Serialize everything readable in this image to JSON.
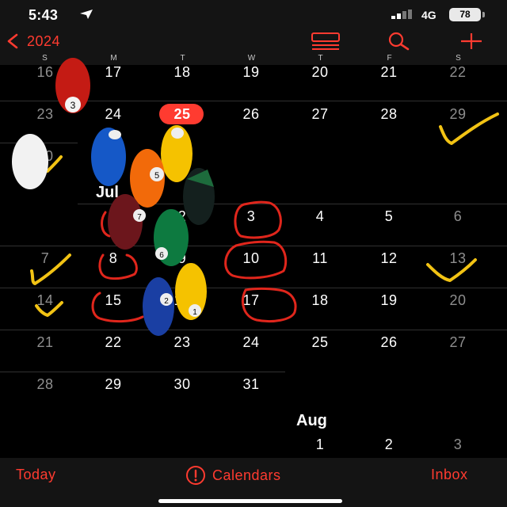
{
  "status_bar": {
    "time": "5:43",
    "network": "4G",
    "battery": "78"
  },
  "nav": {
    "back_label": "2024",
    "weekdays": [
      "S",
      "M",
      "T",
      "W",
      "T",
      "F",
      "S"
    ]
  },
  "calendar": {
    "june_week4": [
      "16",
      "17",
      "18",
      "19",
      "20",
      "21",
      "22"
    ],
    "june_week5": [
      "23",
      "24",
      "25",
      "26",
      "27",
      "28",
      "29"
    ],
    "june_last": "30",
    "july_label": "Jul",
    "july_week1": [
      "1",
      "2",
      "3",
      "4",
      "5",
      "6"
    ],
    "july_week2": [
      "7",
      "8",
      "9",
      "10",
      "11",
      "12",
      "13"
    ],
    "july_week3": [
      "14",
      "15",
      "16",
      "17",
      "18",
      "19",
      "20"
    ],
    "july_week4": [
      "21",
      "22",
      "23",
      "24",
      "25",
      "26",
      "27"
    ],
    "july_week5": [
      "28",
      "29",
      "30",
      "31"
    ],
    "aug_label": "Aug",
    "aug_week1": [
      "1",
      "2",
      "3"
    ],
    "today": "25"
  },
  "tab_bar": {
    "today": "Today",
    "calendars": "Calendars",
    "inbox": "Inbox"
  },
  "overlay_stickers": {
    "pool_balls": [
      {
        "number": "3"
      },
      {
        "number": ""
      },
      {
        "number": ""
      },
      {
        "number": ""
      },
      {
        "number": "5"
      },
      {
        "number": ""
      },
      {
        "number": "7"
      },
      {
        "number": "6"
      },
      {
        "number": "2"
      },
      {
        "number": "1"
      }
    ]
  },
  "colors": {
    "accent": "#ff3b30",
    "background": "#000000",
    "bar": "#141414",
    "checkmark": "#f2c314"
  }
}
